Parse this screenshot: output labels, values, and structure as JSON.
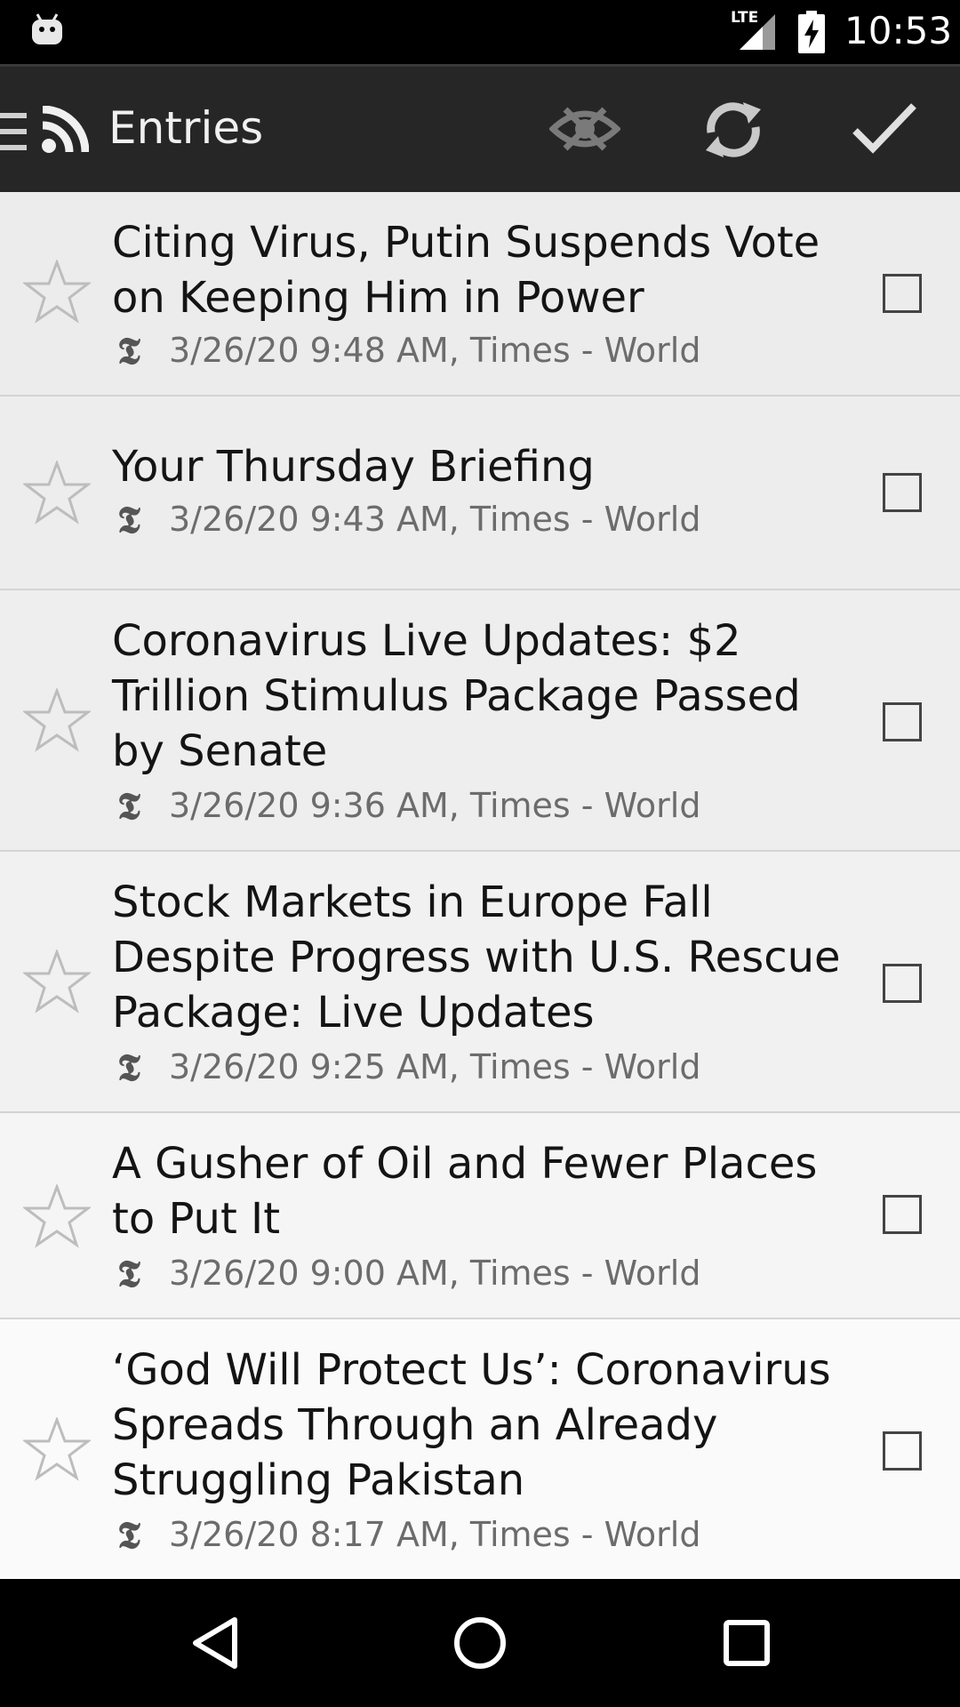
{
  "status_bar": {
    "network_label": "LTE",
    "time": "10:53"
  },
  "action_bar": {
    "title": "Entries",
    "icons": [
      "menu-icon",
      "rss-icon",
      "hide-read-icon",
      "refresh-icon",
      "mark-all-read-icon"
    ]
  },
  "entries": [
    {
      "title": "Citing Virus, Putin Suspends Vote on Keeping Him in Power",
      "meta": "3/26/20 9:48 AM, Times - World",
      "starred": false,
      "checked": false
    },
    {
      "title": "Your Thursday Briefing",
      "meta": "3/26/20 9:43 AM, Times - World",
      "starred": false,
      "checked": false
    },
    {
      "title": "Coronavirus Live Updates: $2 Trillion Stimulus Package Passed by Senate",
      "meta": "3/26/20 9:36 AM, Times - World",
      "starred": false,
      "checked": false
    },
    {
      "title": "Stock Markets in Europe Fall Despite Progress with U.S. Rescue Package: Live Updates",
      "meta": "3/26/20 9:25 AM, Times - World",
      "starred": false,
      "checked": false
    },
    {
      "title": "A Gusher of Oil and Fewer Places to Put It",
      "meta": "3/26/20 9:00 AM, Times - World",
      "starred": false,
      "checked": false
    },
    {
      "title": "‘God Will Protect Us’: Coronavirus Spreads Through an Already Struggling Pakistan",
      "meta": "3/26/20 8:17 AM, Times - World",
      "starred": false,
      "checked": false
    }
  ],
  "feed_logo_glyph": "𝕿",
  "colors": {
    "action_bar": "#262626",
    "list_background": "#efefef",
    "title_text": "#141414",
    "meta_text": "#6c6c6c"
  }
}
